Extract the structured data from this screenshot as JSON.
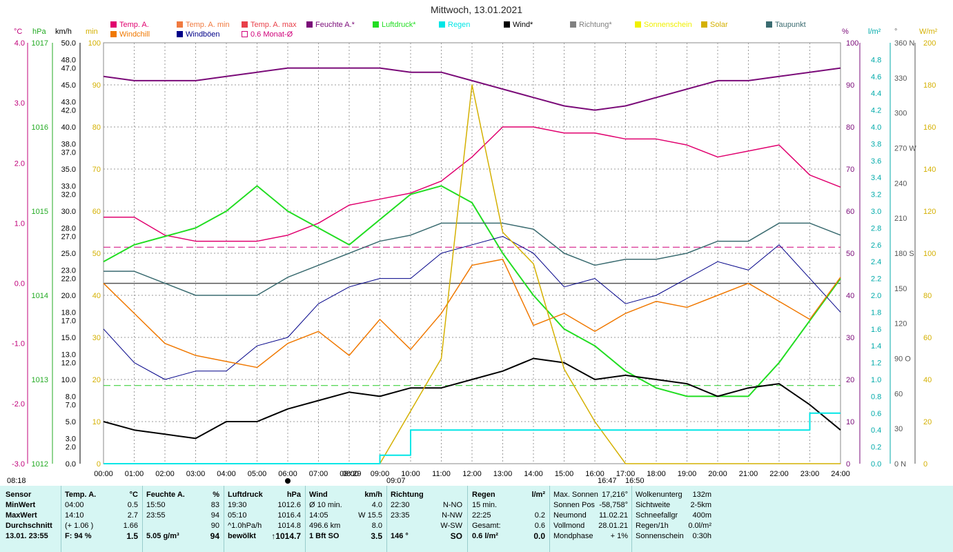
{
  "title": "Mittwoch, 13.01.2021",
  "legend": [
    {
      "label": "Temp. A.",
      "color": "#e0006e"
    },
    {
      "label": "Temp. A. min",
      "color": "#f07a40"
    },
    {
      "label": "Temp. A. max",
      "color": "#e8404a"
    },
    {
      "label": "Feuchte A.*",
      "color": "#7a0a78"
    },
    {
      "label": "Luftdruck*",
      "color": "#22dd22"
    },
    {
      "label": "Regen",
      "color": "#00e6e6"
    },
    {
      "label": "Wind*",
      "color": "#000000"
    },
    {
      "label": "Richtung*",
      "color": "#808080"
    },
    {
      "label": "Sonnenschein",
      "color": "#f0f000"
    },
    {
      "label": "Solar",
      "color": "#d4b000"
    },
    {
      "label": "Taupunkt",
      "color": "#3a6b70"
    },
    {
      "label": "Windchill",
      "color": "#f07800"
    },
    {
      "label": "Windböen",
      "color": "#000088"
    },
    {
      "label": "0.6 Monat-Ø",
      "color": "#d0007a"
    }
  ],
  "units": {
    "temp": "°C",
    "pressure": "hPa",
    "wind": "km/h",
    "sun_min": "min",
    "humidity": "%",
    "rain": "l/m²",
    "direction": "°",
    "solar": "W/m²"
  },
  "axes": {
    "temp": [
      "4.0",
      "3.0",
      "2.0",
      "1.0",
      "0.0",
      "-1.0",
      "-2.0",
      "-3.0"
    ],
    "pressure": [
      "1017",
      "1016",
      "1015",
      "1014",
      "1013",
      "1012"
    ],
    "wind": [
      "50.0",
      "48.0",
      "47.0",
      "45.0",
      "43.0",
      "42.0",
      "40.0",
      "38.0",
      "37.0",
      "35.0",
      "33.0",
      "32.0",
      "30.0",
      "28.0",
      "27.0",
      "25.0",
      "23.0",
      "22.0",
      "20.0",
      "18.0",
      "17.0",
      "15.0",
      "13.0",
      "12.0",
      "10.0",
      "8.0",
      "7.0",
      "5.0",
      "3.0",
      "2.0",
      "0.0"
    ],
    "sun_min": [
      "100",
      "90",
      "80",
      "70",
      "60",
      "50",
      "40",
      "30",
      "20",
      "10",
      "0"
    ],
    "humidity": [
      "100",
      "90",
      "80",
      "70",
      "60",
      "50",
      "40",
      "30",
      "20",
      "10",
      "0"
    ],
    "rain": [
      "4.8",
      "4.6",
      "4.4",
      "4.2",
      "4.0",
      "3.8",
      "3.6",
      "3.4",
      "3.2",
      "3.0",
      "2.8",
      "2.6",
      "2.4",
      "2.2",
      "2.0",
      "1.8",
      "1.6",
      "1.4",
      "1.2",
      "1.0",
      "0.8",
      "0.6",
      "0.4",
      "0.2",
      "0.0"
    ],
    "direction": [
      "360 N",
      "330",
      "300",
      "270 W",
      "240",
      "210",
      "180 S",
      "150",
      "120",
      "90  O",
      "60",
      "30",
      "0  N"
    ],
    "solar": [
      "200",
      "180",
      "160",
      "140",
      "120",
      "100",
      "80",
      "60",
      "40",
      "20",
      "0"
    ],
    "time": [
      "00:00",
      "01:00",
      "02:00",
      "03:00",
      "04:00",
      "05:00",
      "06:00",
      "07:00",
      "08:00",
      "09:00",
      "10:00",
      "11:00",
      "12:00",
      "13:00",
      "14:00",
      "15:00",
      "16:00",
      "17:00",
      "18:00",
      "19:00",
      "20:00",
      "21:00",
      "22:00",
      "23:00",
      "24:00"
    ]
  },
  "sun_markers": {
    "sunrise": "08:18",
    "civil_a": "08:29",
    "civil_b": "09:07",
    "sunset_a": "16:47",
    "sunset_b": "16:50"
  },
  "chart_data": {
    "type": "line",
    "x_hours": [
      0,
      1,
      2,
      3,
      4,
      5,
      6,
      7,
      8,
      9,
      10,
      11,
      12,
      13,
      14,
      15,
      16,
      17,
      18,
      19,
      20,
      21,
      22,
      23,
      24
    ],
    "series": [
      {
        "name": "Temp. A.",
        "unit": "°C",
        "values": [
          1.1,
          1.1,
          0.8,
          0.7,
          0.7,
          0.7,
          0.8,
          1.0,
          1.3,
          1.4,
          1.5,
          1.7,
          2.1,
          2.6,
          2.6,
          2.5,
          2.5,
          2.4,
          2.4,
          2.3,
          2.1,
          2.2,
          2.3,
          1.8,
          1.6
        ]
      },
      {
        "name": "Feuchte A.*",
        "unit": "%",
        "values": [
          92,
          91,
          91,
          91,
          92,
          93,
          94,
          94,
          94,
          94,
          93,
          93,
          91,
          89,
          87,
          85,
          84,
          85,
          87,
          89,
          91,
          91,
          92,
          93,
          94
        ]
      },
      {
        "name": "Luftdruck*",
        "unit": "hPa",
        "values": [
          1014.4,
          1014.6,
          1014.7,
          1014.8,
          1015.0,
          1015.3,
          1015.0,
          1014.8,
          1014.6,
          1014.9,
          1015.2,
          1015.3,
          1015.1,
          1014.5,
          1014.0,
          1013.6,
          1013.4,
          1013.1,
          1012.9,
          1012.8,
          1012.8,
          1012.8,
          1013.2,
          1013.7,
          1014.2
        ]
      },
      {
        "name": "Taupunkt",
        "unit": "°C",
        "values": [
          0.2,
          0.2,
          0.0,
          -0.2,
          -0.2,
          -0.2,
          0.1,
          0.3,
          0.5,
          0.7,
          0.8,
          1.0,
          1.0,
          1.0,
          0.9,
          0.5,
          0.3,
          0.4,
          0.4,
          0.5,
          0.7,
          0.7,
          1.0,
          1.0,
          0.8
        ]
      },
      {
        "name": "Wind*",
        "unit": "km/h",
        "values": [
          5.0,
          4.0,
          3.5,
          3.0,
          5.0,
          5.0,
          6.5,
          7.5,
          8.5,
          8.0,
          9.0,
          9.0,
          10.0,
          11.0,
          12.5,
          12.0,
          10.0,
          10.5,
          10.0,
          9.5,
          8.0,
          9.0,
          9.5,
          7.0,
          4.0
        ]
      },
      {
        "name": "Windböen",
        "unit": "km/h",
        "values": [
          16,
          12,
          10,
          11,
          11,
          14,
          15,
          19,
          21,
          22,
          22,
          25,
          26,
          27,
          25,
          21,
          22,
          19,
          20,
          22,
          24,
          23,
          26,
          22,
          18
        ]
      },
      {
        "name": "Windchill",
        "unit": "°C",
        "values": [
          0.0,
          -0.5,
          -1.0,
          -1.2,
          -1.3,
          -1.4,
          -1.0,
          -0.8,
          -1.2,
          -0.6,
          -1.1,
          -0.5,
          0.3,
          0.4,
          -0.7,
          -0.5,
          -0.8,
          -0.5,
          -0.3,
          -0.4,
          -0.2,
          0.0,
          -0.3,
          -0.6,
          0.1
        ]
      },
      {
        "name": "Solar",
        "unit": "W/m²",
        "values": [
          0,
          0,
          0,
          0,
          0,
          0,
          0,
          0,
          0,
          0,
          25,
          50,
          180,
          110,
          95,
          45,
          20,
          0,
          0,
          0,
          0,
          0,
          0,
          0,
          0
        ]
      },
      {
        "name": "Regen",
        "unit": "l/m²",
        "values": [
          0,
          0,
          0,
          0,
          0,
          0,
          0,
          0,
          0,
          0.1,
          0.4,
          0.4,
          0.4,
          0.4,
          0.4,
          0.4,
          0.4,
          0.4,
          0.4,
          0.4,
          0.4,
          0.4,
          0.4,
          0.6,
          0.6
        ]
      }
    ],
    "reference_lines": [
      {
        "name": "0.6 Monat-Ø",
        "unit": "°C",
        "value": 0.6
      }
    ],
    "xlabel": "",
    "ylabel": ""
  },
  "stats": {
    "c1": {
      "h": "Sensor",
      "rows": [
        "MinWert",
        "MaxWert",
        "Durchschnitt",
        "13.01. 23:55"
      ]
    },
    "c2": {
      "h": "Temp. A.",
      "u": "°C",
      "rows": [
        [
          "04:00",
          "0.5"
        ],
        [
          "14:10",
          "2.7"
        ],
        [
          "(+ 1.06 )",
          "1.66"
        ],
        [
          "F: 94 %",
          "1.5"
        ]
      ]
    },
    "c3": {
      "h": "Feuchte A.",
      "u": "%",
      "rows": [
        [
          "15:50",
          "83"
        ],
        [
          "23:55",
          "94"
        ],
        [
          "",
          "90"
        ],
        [
          "5.05 g/m³",
          "94"
        ]
      ]
    },
    "c4": {
      "h": "Luftdruck",
      "u": "hPa",
      "rows": [
        [
          "19:30",
          "1012.6"
        ],
        [
          "05:10",
          "1016.4"
        ],
        [
          "^1.0hPa/h",
          "1014.8"
        ],
        [
          "bewölkt",
          "↑1014.7"
        ]
      ]
    },
    "c5": {
      "h": "Wind",
      "u": "km/h",
      "rows": [
        [
          "Ø 10 min.",
          "4.0"
        ],
        [
          "14:05",
          "W 15.5"
        ],
        [
          "496.6 km",
          "8.0"
        ],
        [
          "1 Bft SO",
          "3.5"
        ]
      ]
    },
    "c6": {
      "h": "Richtung",
      "rows": [
        [
          "22:30",
          "N-NO"
        ],
        [
          "23:35",
          "N-NW"
        ],
        [
          "",
          "W-SW"
        ],
        [
          "146 °",
          "SO"
        ]
      ]
    },
    "c7": {
      "h": "Regen",
      "u": "l/m²",
      "rows": [
        [
          "15 min.",
          ""
        ],
        [
          "22:25",
          "0.2"
        ],
        [
          "Gesamt:",
          "0.6"
        ],
        [
          "0.6 l/m²",
          "0.0"
        ]
      ]
    },
    "c8": {
      "rows": [
        [
          "Max. Sonnen",
          "17,216°"
        ],
        [
          "Sonnen Pos",
          "-58,758°"
        ],
        [
          "Neumond",
          "11.02.21"
        ],
        [
          "Vollmond",
          "28.01.21"
        ],
        [
          "Mondphase",
          "+ 1%"
        ]
      ]
    },
    "c9": {
      "rows": [
        [
          "Wolkenunterg",
          "132m"
        ],
        [
          "Sichtweite",
          "2-5km"
        ],
        [
          "Schneefallgr",
          "400m"
        ],
        [
          "Regen/1h",
          "0.0l/m²"
        ],
        [
          "Sonnenschein",
          "0:30h"
        ]
      ]
    }
  }
}
